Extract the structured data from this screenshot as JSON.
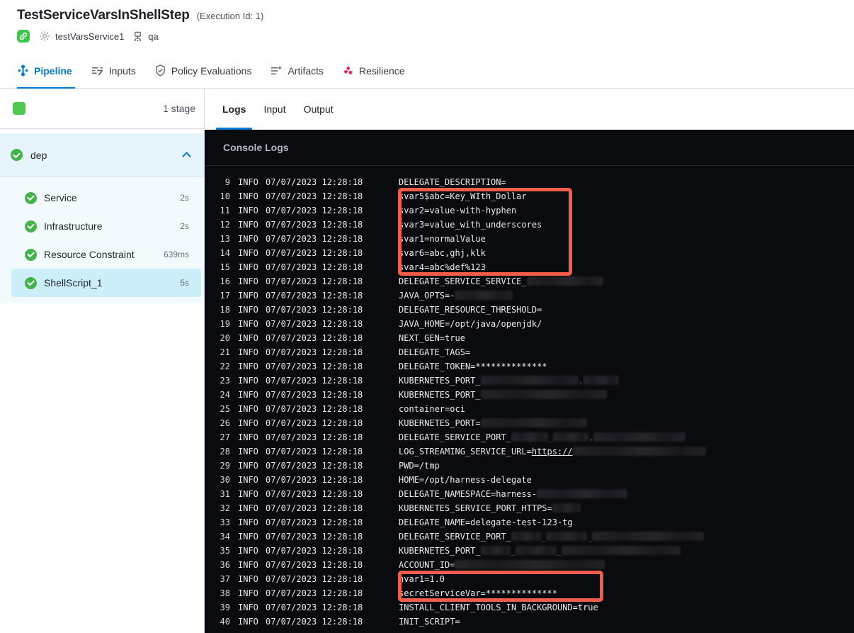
{
  "header": {
    "title": "TestServiceVarsInShellStep",
    "execution_id_label": "(Execution Id: 1)",
    "service_name": "testVarsService1",
    "environment_name": "qa"
  },
  "main_tabs": [
    {
      "label": "Pipeline",
      "active": true
    },
    {
      "label": "Inputs",
      "active": false
    },
    {
      "label": "Policy Evaluations",
      "active": false
    },
    {
      "label": "Artifacts",
      "active": false
    },
    {
      "label": "Resilience",
      "active": false
    }
  ],
  "sidebar": {
    "stage_count_label": "1 stage",
    "group": {
      "name": "dep",
      "status": "success",
      "expanded": true
    },
    "steps": [
      {
        "label": "Service",
        "duration": "2s",
        "status": "success",
        "selected": false
      },
      {
        "label": "Infrastructure",
        "duration": "2s",
        "status": "success",
        "selected": false
      },
      {
        "label": "Resource Constraint",
        "duration": "639ms",
        "status": "success",
        "selected": false
      },
      {
        "label": "ShellScript_1",
        "duration": "5s",
        "status": "success",
        "selected": true
      }
    ]
  },
  "log_panel": {
    "tabs": [
      {
        "label": "Logs",
        "active": true
      },
      {
        "label": "Input",
        "active": false
      },
      {
        "label": "Output",
        "active": false
      }
    ],
    "console_title": "Console Logs",
    "highlights": [
      {
        "name": "service-vars-highlight",
        "from_line": 10,
        "to_line": 15
      },
      {
        "name": "numeric-and-secret-vars-highlight",
        "from_line": 37,
        "to_line": 38
      }
    ],
    "logs": {
      "lines": [
        {
          "n": 9,
          "level": "INFO",
          "time": "07/07/2023 12:28:18",
          "parts": [
            {
              "t": "DELEGATE_DESCRIPTION="
            }
          ]
        },
        {
          "n": 10,
          "level": "INFO",
          "time": "07/07/2023 12:28:18",
          "parts": [
            {
              "t": "svar5$abc=Key_WIth_Dollar"
            }
          ]
        },
        {
          "n": 11,
          "level": "INFO",
          "time": "07/07/2023 12:28:18",
          "parts": [
            {
              "t": "svar2=value-with-hyphen"
            }
          ]
        },
        {
          "n": 12,
          "level": "INFO",
          "time": "07/07/2023 12:28:18",
          "parts": [
            {
              "t": "svar3=value_with_underscores"
            }
          ]
        },
        {
          "n": 13,
          "level": "INFO",
          "time": "07/07/2023 12:28:18",
          "parts": [
            {
              "t": "svar1=normalValue"
            }
          ]
        },
        {
          "n": 14,
          "level": "INFO",
          "time": "07/07/2023 12:28:18",
          "parts": [
            {
              "t": "svar6=abc,ghj,klk"
            }
          ]
        },
        {
          "n": 15,
          "level": "INFO",
          "time": "07/07/2023 12:28:18",
          "parts": [
            {
              "t": "svar4=abc%def%123"
            }
          ]
        },
        {
          "n": 16,
          "level": "INFO",
          "time": "07/07/2023 12:28:18",
          "parts": [
            {
              "t": "DELEGATE_SERVICE_SERVICE_"
            },
            {
              "redact": 108
            }
          ]
        },
        {
          "n": 17,
          "level": "INFO",
          "time": "07/07/2023 12:28:18",
          "parts": [
            {
              "t": "JAVA_OPTS=-"
            },
            {
              "redact": 82
            }
          ]
        },
        {
          "n": 18,
          "level": "INFO",
          "time": "07/07/2023 12:28:18",
          "parts": [
            {
              "t": "DELEGATE_RESOURCE_THRESHOLD="
            }
          ]
        },
        {
          "n": 19,
          "level": "INFO",
          "time": "07/07/2023 12:28:18",
          "parts": [
            {
              "t": "JAVA_HOME=/opt/java/openjdk/"
            }
          ]
        },
        {
          "n": 20,
          "level": "INFO",
          "time": "07/07/2023 12:28:18",
          "parts": [
            {
              "t": "NEXT_GEN=true"
            }
          ]
        },
        {
          "n": 21,
          "level": "INFO",
          "time": "07/07/2023 12:28:18",
          "parts": [
            {
              "t": "DELEGATE_TAGS="
            }
          ]
        },
        {
          "n": 22,
          "level": "INFO",
          "time": "07/07/2023 12:28:18",
          "parts": [
            {
              "t": "DELEGATE_TOKEN=**************"
            }
          ]
        },
        {
          "n": 23,
          "level": "INFO",
          "time": "07/07/2023 12:28:18",
          "parts": [
            {
              "t": "KUBERNETES_PORT_"
            },
            {
              "redact": 138
            },
            {
              "t": ",",
              "dim": true
            },
            {
              "redact": 50
            }
          ]
        },
        {
          "n": 24,
          "level": "INFO",
          "time": "07/07/2023 12:28:18",
          "parts": [
            {
              "t": "KUBERNETES_PORT_"
            },
            {
              "redact": 178
            }
          ]
        },
        {
          "n": 25,
          "level": "INFO",
          "time": "07/07/2023 12:28:18",
          "parts": [
            {
              "t": "container=oci"
            }
          ]
        },
        {
          "n": 26,
          "level": "INFO",
          "time": "07/07/2023 12:28:18",
          "parts": [
            {
              "t": "KUBERNETES_PORT="
            },
            {
              "redact": 150
            }
          ]
        },
        {
          "n": 27,
          "level": "INFO",
          "time": "07/07/2023 12:28:18",
          "parts": [
            {
              "t": "DELEGATE_SERVICE_PORT_"
            },
            {
              "redact": 52
            },
            {
              "t": "_",
              "dim": true
            },
            {
              "redact": 50
            },
            {
              "t": ",",
              "dim": true
            },
            {
              "redact": 130
            }
          ]
        },
        {
          "n": 28,
          "level": "INFO",
          "time": "07/07/2023 12:28:18",
          "parts": [
            {
              "t": "LOG_STREAMING_SERVICE_URL="
            },
            {
              "t": "https://",
              "link": true
            },
            {
              "redact": 188
            }
          ]
        },
        {
          "n": 29,
          "level": "INFO",
          "time": "07/07/2023 12:28:18",
          "parts": [
            {
              "t": "PWD=/tmp"
            }
          ]
        },
        {
          "n": 30,
          "level": "INFO",
          "time": "07/07/2023 12:28:18",
          "parts": [
            {
              "t": "HOME=/opt/harness-delegate"
            }
          ]
        },
        {
          "n": 31,
          "level": "INFO",
          "time": "07/07/2023 12:28:18",
          "parts": [
            {
              "t": "DELEGATE_NAMESPACE=harness-"
            },
            {
              "redact": 128
            }
          ]
        },
        {
          "n": 32,
          "level": "INFO",
          "time": "07/07/2023 12:28:18",
          "parts": [
            {
              "t": "KUBERNETES_SERVICE_PORT_HTTPS="
            },
            {
              "redact": 40
            }
          ]
        },
        {
          "n": 33,
          "level": "INFO",
          "time": "07/07/2023 12:28:18",
          "parts": [
            {
              "t": "DELEGATE_NAME=delegate-test-123-tg"
            }
          ]
        },
        {
          "n": 34,
          "level": "INFO",
          "time": "07/07/2023 12:28:18",
          "parts": [
            {
              "t": "DELEGATE_SERVICE_PORT_"
            },
            {
              "redact": 42
            },
            {
              "t": "_",
              "dim": true
            },
            {
              "redact": 58
            },
            {
              "t": "_",
              "dim": true
            },
            {
              "redact": 158
            }
          ]
        },
        {
          "n": 35,
          "level": "INFO",
          "time": "07/07/2023 12:28:18",
          "parts": [
            {
              "t": "KUBERNETES_PORT_"
            },
            {
              "redact": 42
            },
            {
              "t": "_",
              "dim": true
            },
            {
              "redact": 58
            },
            {
              "t": "_",
              "dim": true
            },
            {
              "redact": 168
            }
          ]
        },
        {
          "n": 36,
          "level": "INFO",
          "time": "07/07/2023 12:28:18",
          "parts": [
            {
              "t": "ACCOUNT_ID="
            },
            {
              "redact": 212
            }
          ]
        },
        {
          "n": 37,
          "level": "INFO",
          "time": "07/07/2023 12:28:18",
          "parts": [
            {
              "t": "nvar1=1.0"
            }
          ]
        },
        {
          "n": 38,
          "level": "INFO",
          "time": "07/07/2023 12:28:18",
          "parts": [
            {
              "t": "secretServiceVar=**************"
            }
          ]
        },
        {
          "n": 39,
          "level": "INFO",
          "time": "07/07/2023 12:28:18",
          "parts": [
            {
              "t": "INSTALL_CLIENT_TOOLS_IN_BACKGROUND=true"
            }
          ]
        },
        {
          "n": 40,
          "level": "INFO",
          "time": "07/07/2023 12:28:18",
          "parts": [
            {
              "t": "INIT_SCRIPT="
            }
          ]
        }
      ]
    }
  },
  "colors": {
    "accent_blue": "#0278d5",
    "success_green": "#42b44a",
    "highlight_red": "#f25c4a",
    "resilience_pink": "#e3275d",
    "selected_row_bg": "#cdeffa",
    "console_bg": "#0a0b0e"
  }
}
